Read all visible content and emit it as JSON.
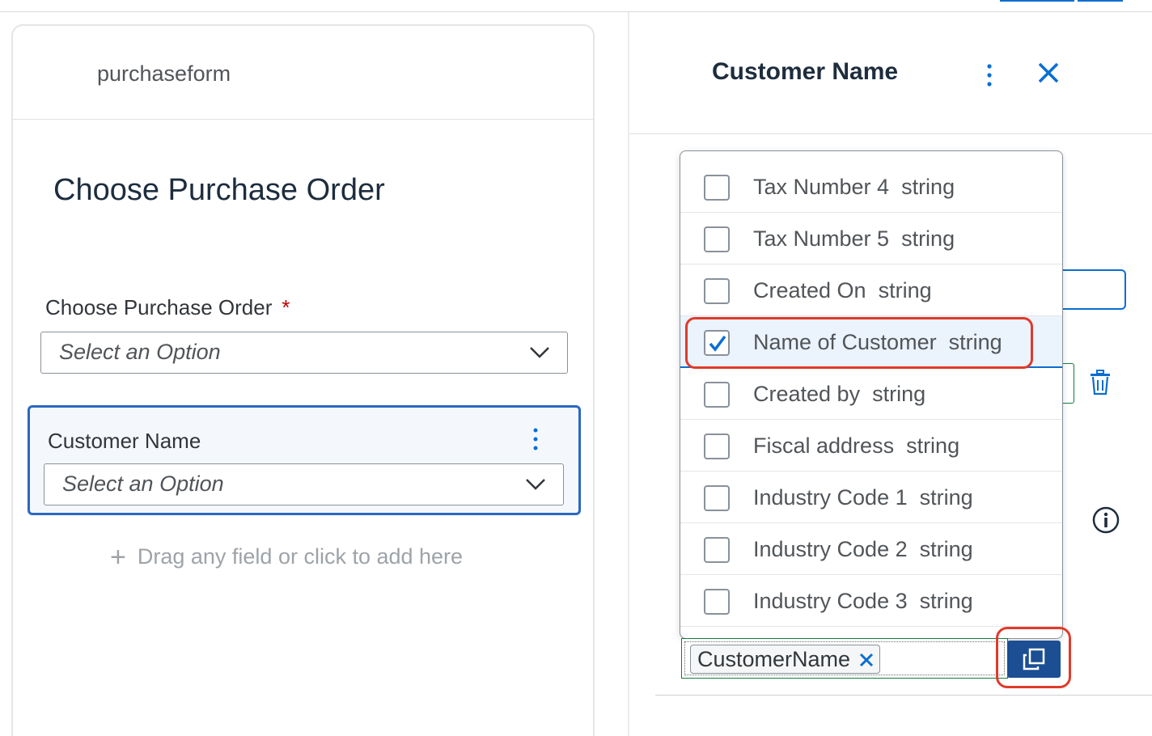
{
  "left": {
    "form_name": "purchaseform",
    "section_title": "Choose Purchase Order",
    "po_field": {
      "label": "Choose Purchase Order",
      "required_mark": "*",
      "placeholder": "Select an Option"
    },
    "customer_field": {
      "label": "Customer Name",
      "placeholder": "Select an Option"
    },
    "drag_hint": "Drag any field or click to add here"
  },
  "right": {
    "title": "Customer Name",
    "dropdown": {
      "items": [
        {
          "label": "Tax Number 4  string",
          "checked": false
        },
        {
          "label": "Tax Number 5  string",
          "checked": false
        },
        {
          "label": "Created On  string",
          "checked": false
        },
        {
          "label": "Name of Customer  string",
          "checked": true
        },
        {
          "label": "Created by  string",
          "checked": false
        },
        {
          "label": "Fiscal address  string",
          "checked": false
        },
        {
          "label": "Industry Code 1  string",
          "checked": false
        },
        {
          "label": "Industry Code 2  string",
          "checked": false
        },
        {
          "label": "Industry Code 3  string",
          "checked": false
        }
      ]
    },
    "token": "CustomerName"
  },
  "colors": {
    "accent": "#0a6ed1",
    "highlight": "#e03a2a",
    "button": "#1b4e93",
    "selected_row": "#ebf3fc"
  }
}
